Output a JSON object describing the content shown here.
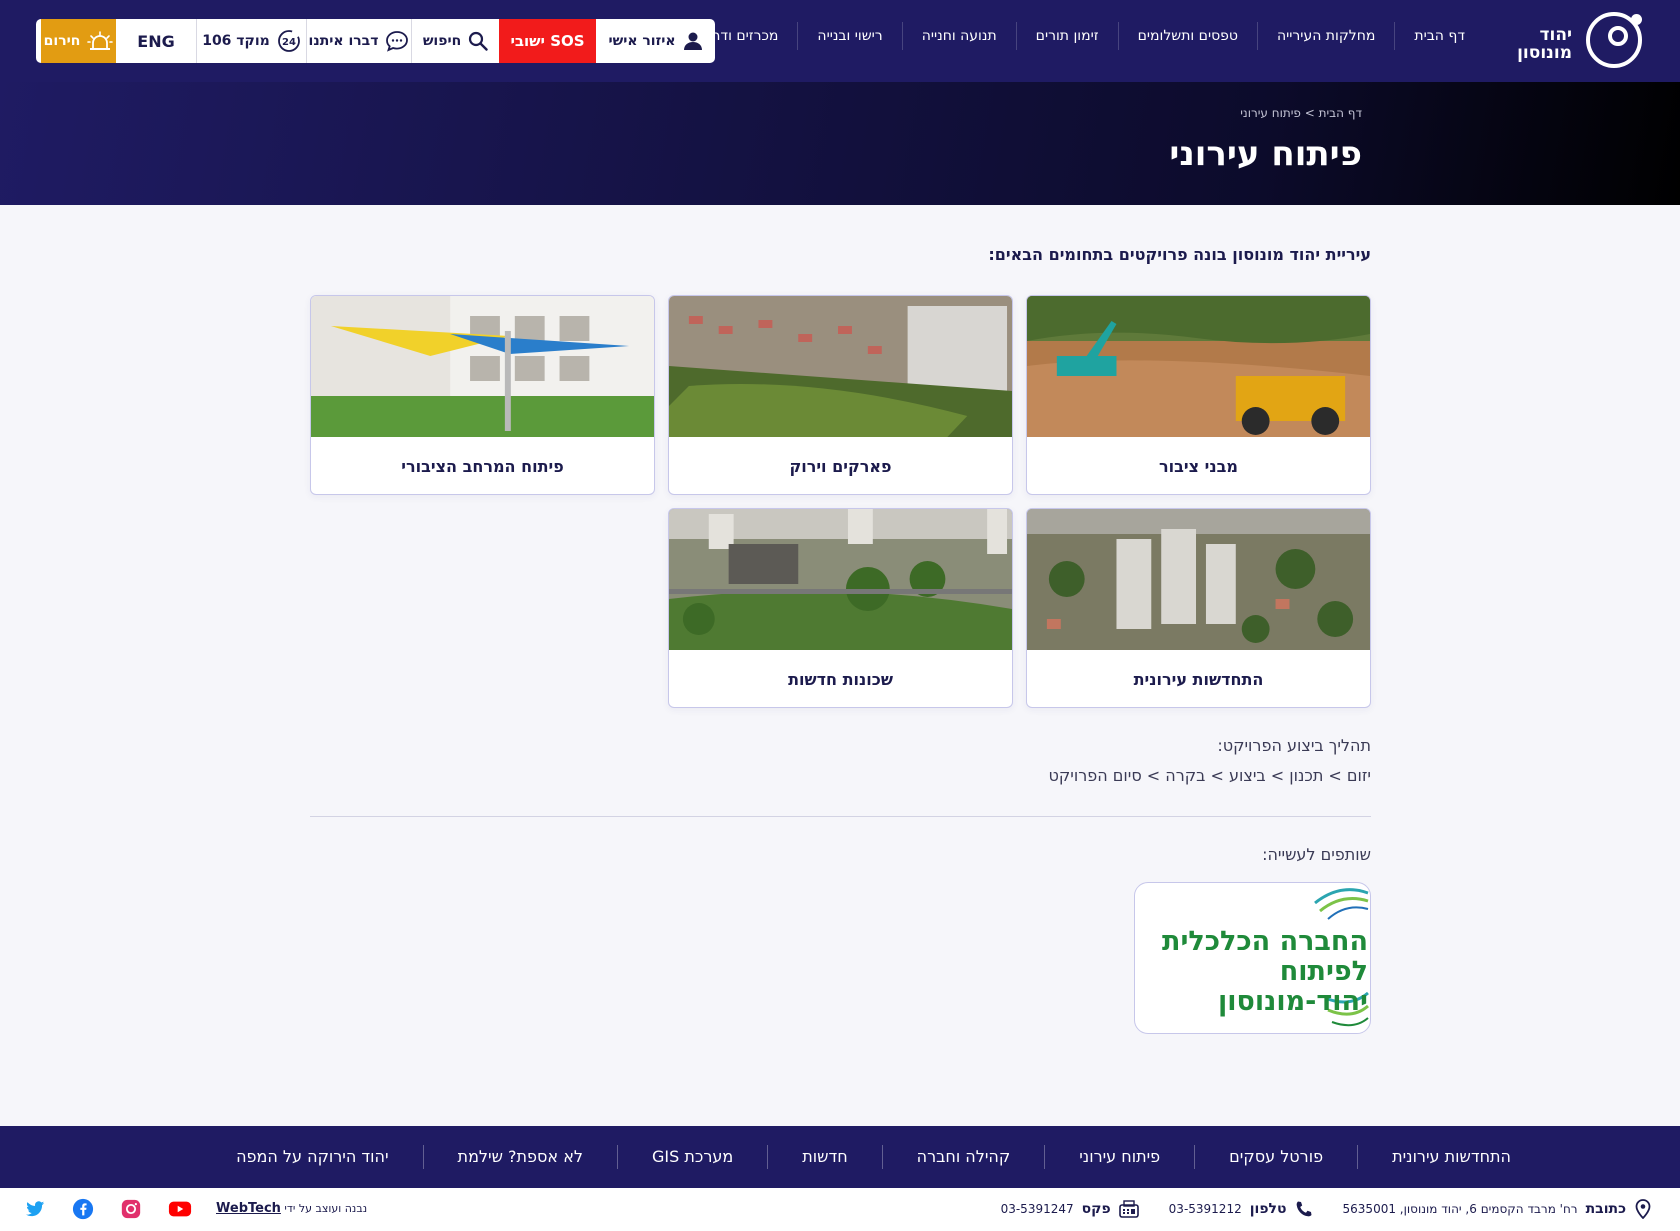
{
  "header": {
    "logo_line1": "יהוד",
    "logo_line2": "מונוסון",
    "nav": [
      "דף הבית",
      "מחלקות העירייה",
      "טפסים ותשלומים",
      "זימון תורים",
      "תנועה וחנייה",
      "רישוי ובנייה",
      "מכרזים ודרושים"
    ],
    "utility": {
      "personal": "איזור אישי",
      "sos": "SOS ישובי",
      "search": "חיפוש",
      "talk": "דברו איתנו",
      "hotline": "מוקד 106",
      "eng": "ENG",
      "alert": "חירום"
    }
  },
  "banner": {
    "breadcrumb": "דף הבית > פיתוח עירוני",
    "title": "פיתוח עירוני"
  },
  "content": {
    "intro": "עיריית יהוד מונוסון בונה פרויקטים בתחומים הבאים:",
    "cards": [
      {
        "label": "מבני ציבור",
        "image": "construction-site-photo"
      },
      {
        "label": "פארקים וירוק",
        "image": "aerial-park-photo"
      },
      {
        "label": "פיתוח המרחב הציבורי",
        "image": "school-shade-photo"
      },
      {
        "label": "התחדשות עירונית",
        "image": "aerial-towers-photo"
      },
      {
        "label": "שכונות חדשות",
        "image": "aerial-neighborhood-photo"
      }
    ],
    "process_title": "תהליך ביצוע הפרויקט:",
    "process_steps": "יזום > תכנון > ביצוע > בקרה > סיום הפרויקט",
    "partners_title": "שותפים לעשייה:",
    "partner": {
      "line1": "החברה הכלכלית",
      "line2": "לפיתוח יהוד-מונוסון"
    }
  },
  "footer": {
    "nav": [
      "התחדשות עירונית",
      "פורטל עסקים",
      "פיתוח עירוני",
      "קהילה וחברה",
      "חדשות",
      "מערכת GIS",
      "לא אספת? שילמת",
      "יהוד הירוקה על המפה"
    ],
    "address_label": "כתובת",
    "address": "רח' מרבד הקסמים 6, יהוד מונוסון, 5635001",
    "phone_label": "טלפון",
    "phone": "03-5391212",
    "fax_label": "פקס",
    "fax": "03-5391247",
    "credit_prefix": "נבנה ועוצב על ידי",
    "credit_name": "WebTech"
  },
  "colors": {
    "navy": "#1f1b63",
    "sos": "#f21b1b",
    "alert": "#e29c12",
    "partner_green": "#1f8a3a"
  }
}
